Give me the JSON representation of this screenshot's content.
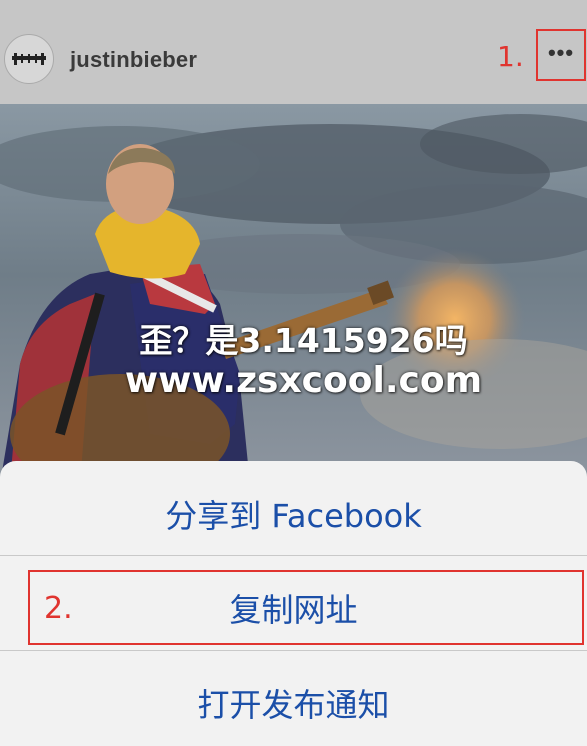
{
  "header": {
    "username": "justinbieber",
    "step1_label": "1.",
    "more_icon": "ellipsis-horizontal",
    "more_glyph": "•••"
  },
  "photo": {
    "watermark_line1": "歪？是3.1415926吗",
    "watermark_line2": "www.zsxcool.com"
  },
  "action_sheet": {
    "items": [
      {
        "label": "分享到 Facebook"
      },
      {
        "label": "复制网址"
      },
      {
        "label": "打开发布通知"
      }
    ],
    "step2_label": "2."
  },
  "colors": {
    "annotation_red": "#e0342f",
    "action_blue": "#1b4fa8",
    "sheet_bg": "#f2f2f2"
  }
}
